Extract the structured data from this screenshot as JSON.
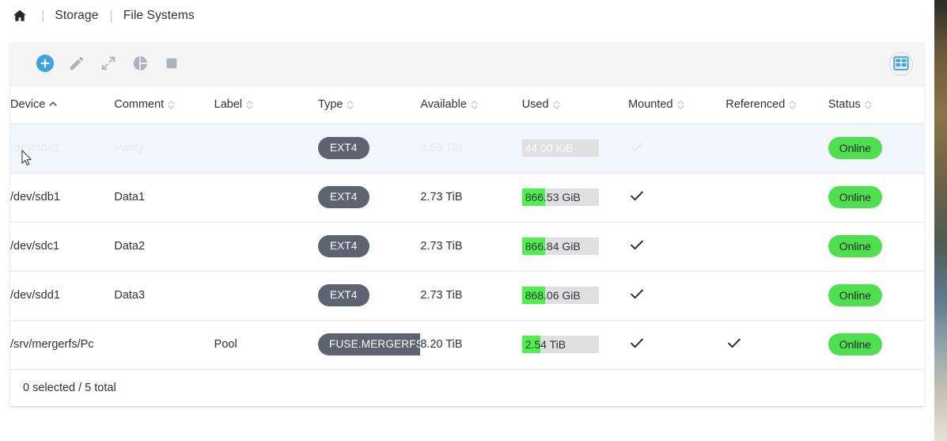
{
  "breadcrumb": {
    "home_icon": "home-icon",
    "separator": "|",
    "items": [
      {
        "label": "Storage",
        "current": false
      },
      {
        "label": "File Systems",
        "current": true
      }
    ]
  },
  "toolbar": {
    "buttons": [
      {
        "name": "create-button",
        "icon": "plus-circle-icon",
        "label": "Create",
        "enabled": true
      },
      {
        "name": "edit-button",
        "icon": "pencil-icon",
        "label": "Edit",
        "enabled": false
      },
      {
        "name": "resize-button",
        "icon": "expand-arrows-icon",
        "label": "Resize",
        "enabled": false
      },
      {
        "name": "quota-button",
        "icon": "half-pie-chart-icon",
        "label": "Quota",
        "enabled": false
      },
      {
        "name": "unmount-button",
        "icon": "stop-square-icon",
        "label": "Unmount",
        "enabled": false
      }
    ],
    "columns_button": {
      "name": "table-columns-button",
      "icon": "grid-table-icon",
      "label": "Columns"
    },
    "accent_color": "#3aa3e8",
    "disabled_color": "#aeb3b9"
  },
  "table": {
    "columns": [
      {
        "key": "device",
        "label": "Device",
        "sort": "asc"
      },
      {
        "key": "comment",
        "label": "Comment",
        "sort": "none"
      },
      {
        "key": "label",
        "label": "Label",
        "sort": "none"
      },
      {
        "key": "type",
        "label": "Type",
        "sort": "none"
      },
      {
        "key": "available",
        "label": "Available",
        "sort": "none"
      },
      {
        "key": "used",
        "label": "Used",
        "sort": "none"
      },
      {
        "key": "mounted",
        "label": "Mounted",
        "sort": "none"
      },
      {
        "key": "referenced",
        "label": "Referenced",
        "sort": "none"
      },
      {
        "key": "status",
        "label": "Status",
        "sort": "none"
      }
    ],
    "rows": [
      {
        "device": "/dev/sda1",
        "comment": "Parity",
        "label": "",
        "type": "EXT4",
        "available": "3.58 TiB",
        "used": "44.00 KiB",
        "used_percent": 0,
        "mounted": true,
        "referenced": false,
        "status": "Online",
        "state": "faded-hover"
      },
      {
        "device": "/dev/sdb1",
        "comment": "Data1",
        "label": "",
        "type": "EXT4",
        "available": "2.73 TiB",
        "used": "866.53 GiB",
        "used_percent": 30,
        "mounted": true,
        "referenced": false,
        "status": "Online",
        "state": "normal"
      },
      {
        "device": "/dev/sdc1",
        "comment": "Data2",
        "label": "",
        "type": "EXT4",
        "available": "2.73 TiB",
        "used": "866.84 GiB",
        "used_percent": 30,
        "mounted": true,
        "referenced": false,
        "status": "Online",
        "state": "normal"
      },
      {
        "device": "/dev/sdd1",
        "comment": "Data3",
        "label": "",
        "type": "EXT4",
        "available": "2.73 TiB",
        "used": "868.06 GiB",
        "used_percent": 30,
        "mounted": true,
        "referenced": false,
        "status": "Online",
        "state": "normal"
      },
      {
        "device": "/srv/mergerfs/Pc",
        "comment": "",
        "label": "Pool",
        "type": "FUSE.MERGERFS",
        "available": "8.20 TiB",
        "used": "2.54 TiB",
        "used_percent": 24,
        "mounted": true,
        "referenced": true,
        "status": "Online",
        "state": "normal"
      }
    ],
    "footer": "0 selected / 5 total"
  },
  "colors": {
    "accent": "#3aa3e8",
    "usage_fill": "#4ef04e",
    "status_badge": "#4ee04e",
    "chip": "#5d6370",
    "row_hover": "#f1f7fd",
    "toolbar_bg": "#f5f5f5"
  }
}
